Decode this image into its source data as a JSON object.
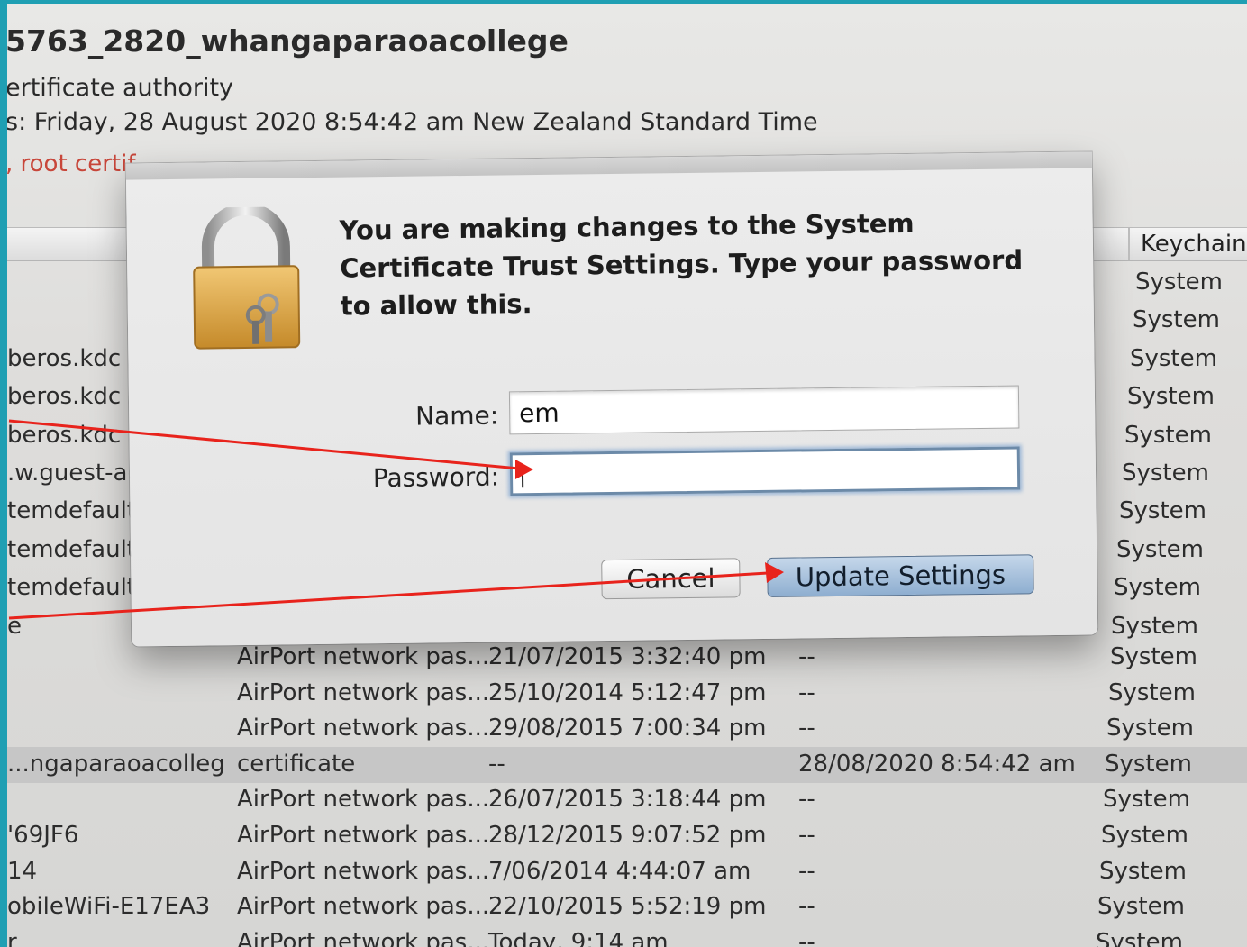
{
  "certificate": {
    "title": "5763_2820_whangaparaoacollege",
    "kind": "ertificate authority",
    "expires": "s: Friday, 28 August 2020 8:54:42 am New Zealand Standard Time",
    "root_note": ", root certif"
  },
  "table": {
    "keychain_header": "Keychain",
    "rows_behind_dialog": [
      {
        "name": "",
        "keychain": "System"
      },
      {
        "name": "",
        "keychain": "System"
      },
      {
        "name": "beros.kdc",
        "keychain": "System"
      },
      {
        "name": "beros.kdc",
        "keychain": "System"
      },
      {
        "name": "beros.kdc",
        "keychain": "System"
      },
      {
        "name": ".w.guest-acc",
        "keychain": "System"
      },
      {
        "name": "temdefault",
        "keychain": "System"
      },
      {
        "name": "temdefault",
        "keychain": "System"
      },
      {
        "name": "temdefault",
        "keychain": "System"
      },
      {
        "name": "e",
        "keychain": "System"
      }
    ],
    "rows": [
      {
        "name": "",
        "kind": "AirPort network pas...",
        "date": "21/07/2015 3:32:40 pm",
        "expires": "--",
        "keychain": "System"
      },
      {
        "name": "",
        "kind": "AirPort network pas...",
        "date": "25/10/2014 5:12:47 pm",
        "expires": "--",
        "keychain": "System"
      },
      {
        "name": "",
        "kind": "AirPort network pas...",
        "date": "29/08/2015 7:00:34 pm",
        "expires": "--",
        "keychain": "System"
      },
      {
        "name": "...ngaparaoacollege",
        "kind": "certificate",
        "date": "--",
        "expires": "28/08/2020 8:54:42 am",
        "keychain": "System"
      },
      {
        "name": "",
        "kind": "AirPort network pas...",
        "date": "26/07/2015 3:18:44 pm",
        "expires": "--",
        "keychain": "System"
      },
      {
        "name": "'69JF6",
        "kind": "AirPort network pas...",
        "date": "28/12/2015 9:07:52 pm",
        "expires": "--",
        "keychain": "System"
      },
      {
        "name": "14",
        "kind": "AirPort network pas...",
        "date": "7/06/2014 4:44:07 am",
        "expires": "--",
        "keychain": "System"
      },
      {
        "name": "obileWiFi-E17EA3",
        "kind": "AirPort network pas...",
        "date": "22/10/2015 5:52:19 pm",
        "expires": "--",
        "keychain": "System"
      },
      {
        "name": "r",
        "kind": "AirPort network pas...",
        "date": "Today, 9:14 am",
        "expires": "--",
        "keychain": "System"
      }
    ]
  },
  "dialog": {
    "icon": "padlock-with-keys-icon",
    "message": "You are making changes to the System Certificate Trust Settings. Type your password to allow this.",
    "name_label": "Name:",
    "name_value": "em",
    "password_label": "Password:",
    "password_value": "",
    "cancel_label": "Cancel",
    "update_label": "Update Settings"
  },
  "annotations": {
    "arrow_color": "#e8231c"
  }
}
